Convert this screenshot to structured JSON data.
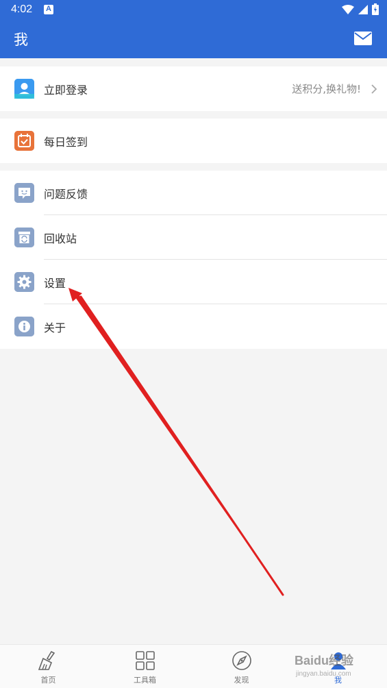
{
  "status_bar": {
    "time": "4:02",
    "notification_icon": "A"
  },
  "app_bar": {
    "title": "我"
  },
  "login": {
    "label": "立即登录",
    "hint": "送积分,换礼物!"
  },
  "checkin": {
    "label": "每日签到"
  },
  "menu": {
    "feedback": "问题反馈",
    "recycle": "回收站",
    "settings": "设置",
    "about": "关于"
  },
  "tabs": {
    "home": "首页",
    "toolbox": "工具箱",
    "discover": "发现",
    "me": "我"
  },
  "watermark": {
    "brand": "Baidu经验",
    "url": "jingyan.baidu.com"
  },
  "colors": {
    "accent": "#2f6bd6",
    "checkin_orange": "#e8733a",
    "menu_icon": "#8aa3c9",
    "annotation_arrow": "#e02020"
  }
}
